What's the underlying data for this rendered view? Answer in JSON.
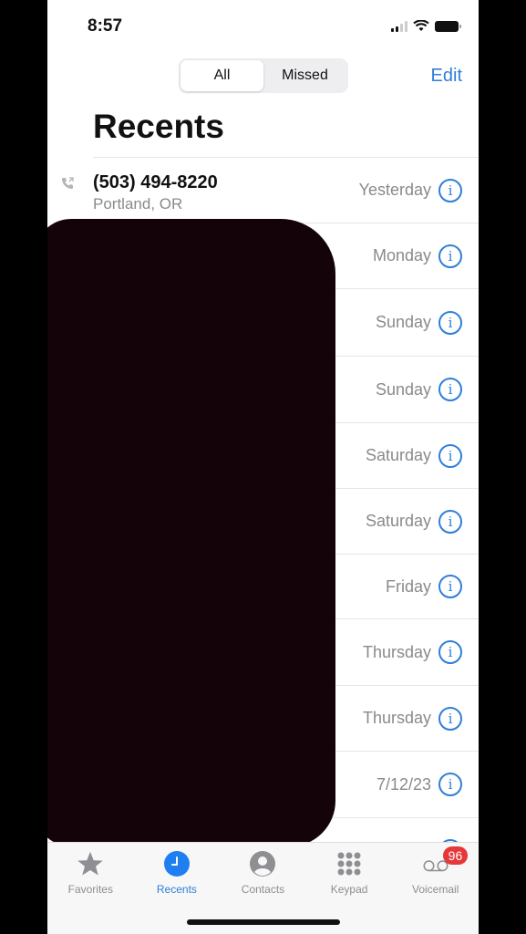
{
  "status_bar": {
    "time": "8:57"
  },
  "header": {
    "segments": [
      {
        "label": "All",
        "active": true
      },
      {
        "label": "Missed",
        "active": false
      }
    ],
    "edit_label": "Edit",
    "title": "Recents"
  },
  "recents": [
    {
      "name": "(503) 494-8220",
      "subtitle": "Portland, OR",
      "date": "Yesterday"
    },
    {
      "name": "",
      "subtitle": "",
      "date": "Monday"
    },
    {
      "name": "",
      "subtitle": "",
      "date": "Sunday"
    },
    {
      "name": "",
      "subtitle": "",
      "date": "Sunday"
    },
    {
      "name": "",
      "subtitle": "",
      "date": "Saturday"
    },
    {
      "name": "",
      "subtitle": "",
      "date": "Saturday"
    },
    {
      "name": "",
      "subtitle": "",
      "date": "Friday"
    },
    {
      "name": "",
      "subtitle": "",
      "date": "Thursday"
    },
    {
      "name": "",
      "subtitle": "",
      "date": "Thursday"
    },
    {
      "name": "",
      "subtitle": "",
      "date": "7/12/23"
    }
  ],
  "info_glyph": "i",
  "tabbar": {
    "tabs": [
      {
        "label": "Favorites",
        "icon": "star-icon"
      },
      {
        "label": "Recents",
        "icon": "clock-icon"
      },
      {
        "label": "Contacts",
        "icon": "person-icon"
      },
      {
        "label": "Keypad",
        "icon": "keypad-icon"
      },
      {
        "label": "Voicemail",
        "icon": "voicemail-icon"
      }
    ],
    "voicemail_badge": "96"
  },
  "colors": {
    "accent": "#2f7fd8",
    "badge": "#e5383b",
    "redaction": "#140308"
  }
}
